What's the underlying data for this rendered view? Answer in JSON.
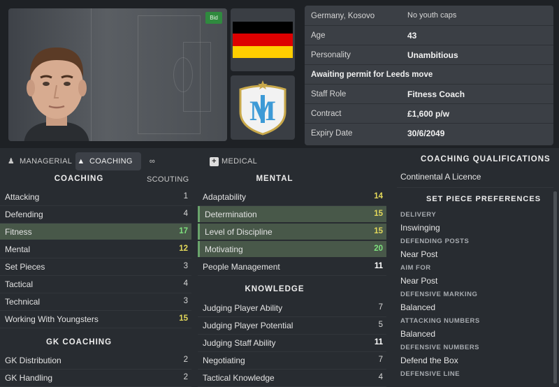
{
  "header": {
    "bid_badge": "Bid",
    "nationality": "Germany, Kosovo",
    "youth_caps": "No youth caps",
    "age_label": "Age",
    "age_value": "43",
    "personality_label": "Personality",
    "personality_value": "Unambitious",
    "permit_notice": "Awaiting permit for Leeds move",
    "staff_role_label": "Staff Role",
    "staff_role_value": "Fitness Coach",
    "contract_label": "Contract",
    "contract_value": "£1,600 p/w",
    "expiry_label": "Expiry Date",
    "expiry_value": "30/6/2049",
    "flag_colors": [
      "#000000",
      "#dd0000",
      "#ffce00"
    ],
    "club_crest": "marseille-crest-icon"
  },
  "tabs": [
    {
      "label": "MANAGERIAL",
      "icon": "person-icon",
      "active": false
    },
    {
      "label": "COACHING",
      "icon": "whistle-icon",
      "active": true
    },
    {
      "label": "SCOUTING",
      "icon": "binoculars-icon",
      "active": false
    },
    {
      "label": "MEDICAL",
      "icon": "medical-kit-icon",
      "active": false
    }
  ],
  "coaching": {
    "title": "COACHING",
    "rows": [
      {
        "name": "Attacking",
        "value": "1"
      },
      {
        "name": "Defending",
        "value": "4"
      },
      {
        "name": "Fitness",
        "value": "17"
      },
      {
        "name": "Mental",
        "value": "12"
      },
      {
        "name": "Set Pieces",
        "value": "3"
      },
      {
        "name": "Tactical",
        "value": "4"
      },
      {
        "name": "Technical",
        "value": "3"
      },
      {
        "name": "Working With Youngsters",
        "value": "15"
      }
    ]
  },
  "gk_coaching": {
    "title": "GK COACHING",
    "rows": [
      {
        "name": "GK Distribution",
        "value": "2"
      },
      {
        "name": "GK Handling",
        "value": "2"
      }
    ]
  },
  "mental": {
    "title": "MENTAL",
    "rows": [
      {
        "name": "Adaptability",
        "value": "14"
      },
      {
        "name": "Determination",
        "value": "15"
      },
      {
        "name": "Level of Discipline",
        "value": "15"
      },
      {
        "name": "Motivating",
        "value": "20"
      },
      {
        "name": "People Management",
        "value": "11"
      }
    ]
  },
  "knowledge": {
    "title": "KNOWLEDGE",
    "rows": [
      {
        "name": "Judging Player Ability",
        "value": "7"
      },
      {
        "name": "Judging Player Potential",
        "value": "5"
      },
      {
        "name": "Judging Staff Ability",
        "value": "11"
      },
      {
        "name": "Negotiating",
        "value": "7"
      },
      {
        "name": "Tactical Knowledge",
        "value": "4"
      }
    ]
  },
  "qualifications": {
    "title": "COACHING QUALIFICATIONS",
    "value": "Continental A Licence"
  },
  "set_piece": {
    "title": "SET PIECE PREFERENCES",
    "items": [
      {
        "label": "DELIVERY",
        "value": "Inswinging"
      },
      {
        "label": "DEFENDING POSTS",
        "value": "Near Post"
      },
      {
        "label": "AIM FOR",
        "value": "Near Post"
      },
      {
        "label": "DEFENSIVE MARKING",
        "value": "Balanced"
      },
      {
        "label": "ATTACKING NUMBERS",
        "value": "Balanced"
      },
      {
        "label": "DEFENSIVE NUMBERS",
        "value": "Defend the Box"
      },
      {
        "label": "DEFENSIVE LINE",
        "value": ""
      }
    ]
  },
  "colors": {
    "good": "#7ee07e",
    "average": "#e3d85a",
    "highlight": "#485849"
  }
}
